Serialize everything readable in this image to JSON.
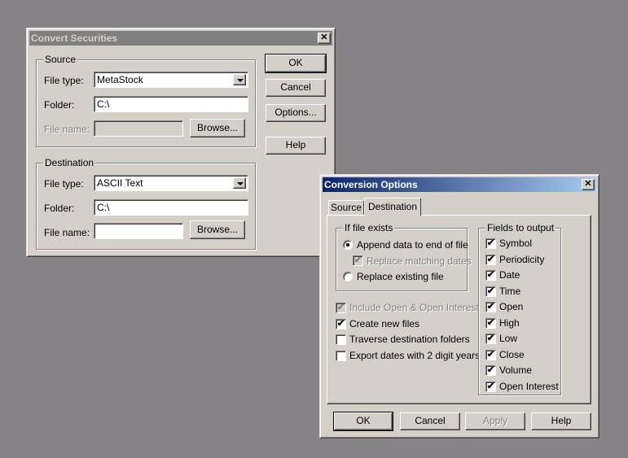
{
  "convert_window": {
    "title": "Convert Securities",
    "source": {
      "legend": "Source",
      "file_type_label": "File type:",
      "file_type_value": "MetaStock",
      "folder_label": "Folder:",
      "folder_value": "C:\\",
      "file_name_label": "File name:",
      "file_name_value": "",
      "browse_label": "Browse..."
    },
    "destination": {
      "legend": "Destination",
      "file_type_label": "File type:",
      "file_type_value": "ASCII Text",
      "folder_label": "Folder:",
      "folder_value": "C:\\",
      "file_name_label": "File name:",
      "file_name_value": "",
      "browse_label": "Browse..."
    },
    "buttons": {
      "ok": "OK",
      "cancel": "Cancel",
      "options": "Options...",
      "help": "Help"
    }
  },
  "options_window": {
    "title": "Conversion Options",
    "tabs": [
      {
        "label": "Source"
      },
      {
        "label": "Destination"
      }
    ],
    "if_exists": {
      "legend": "If file exists",
      "append": "Append data to end of file",
      "replace_dates": "Replace matching dates",
      "replace_file": "Replace existing file"
    },
    "options": [
      {
        "label": "Include Open & Open Interest",
        "checked": true,
        "disabled": true
      },
      {
        "label": "Create new files",
        "checked": true,
        "disabled": false
      },
      {
        "label": "Traverse destination folders",
        "checked": false,
        "disabled": false
      },
      {
        "label": "Export dates with 2 digit years",
        "checked": false,
        "disabled": false
      }
    ],
    "fields": {
      "legend": "Fields to output",
      "items": [
        {
          "label": "Symbol",
          "checked": true
        },
        {
          "label": "Periodicity",
          "checked": true
        },
        {
          "label": "Date",
          "checked": true
        },
        {
          "label": "Time",
          "checked": true
        },
        {
          "label": "Open",
          "checked": true
        },
        {
          "label": "High",
          "checked": true
        },
        {
          "label": "Low",
          "checked": true
        },
        {
          "label": "Close",
          "checked": true
        },
        {
          "label": "Volume",
          "checked": true
        },
        {
          "label": "Open Interest",
          "checked": true
        }
      ]
    },
    "buttons": {
      "ok": "OK",
      "cancel": "Cancel",
      "apply": "Apply",
      "help": "Help"
    }
  },
  "icons": {
    "close": "close-icon",
    "check": "✔"
  },
  "colors": {
    "desktop": "#858386",
    "face": "#d4d0c8",
    "title_active": "#0a246a",
    "title_inactive": "#808080"
  }
}
